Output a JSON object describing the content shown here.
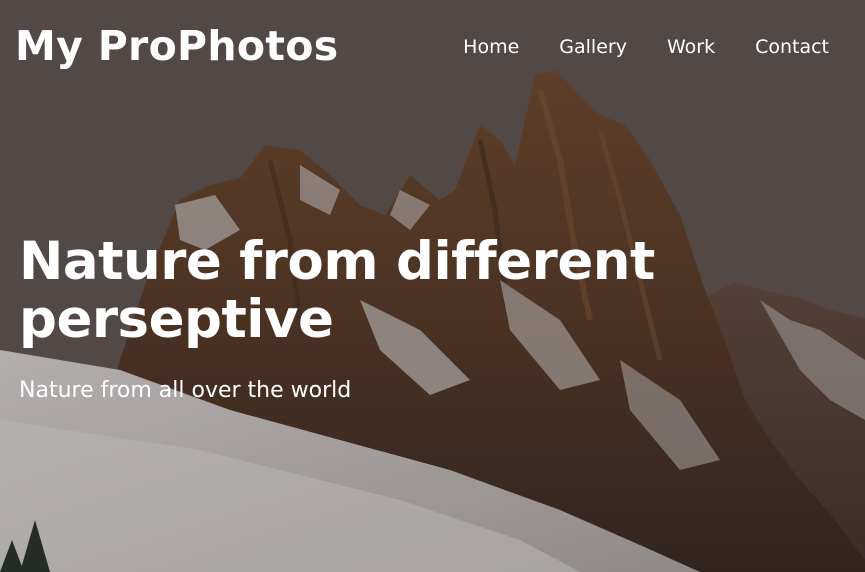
{
  "site": {
    "brand": "My ProPhotos"
  },
  "nav": {
    "items": [
      {
        "label": "Home"
      },
      {
        "label": "Gallery"
      },
      {
        "label": "Work"
      },
      {
        "label": "Contact"
      }
    ]
  },
  "hero": {
    "headline": "Nature from different perseptive",
    "subheadline": "Nature from all over the world",
    "background": "snowy-rocky-mountain-peaks-photo"
  },
  "colors": {
    "sky": "#5f5451",
    "rock": "#6f4a34",
    "snow": "#dcd6d5",
    "text": "#ffffff"
  }
}
